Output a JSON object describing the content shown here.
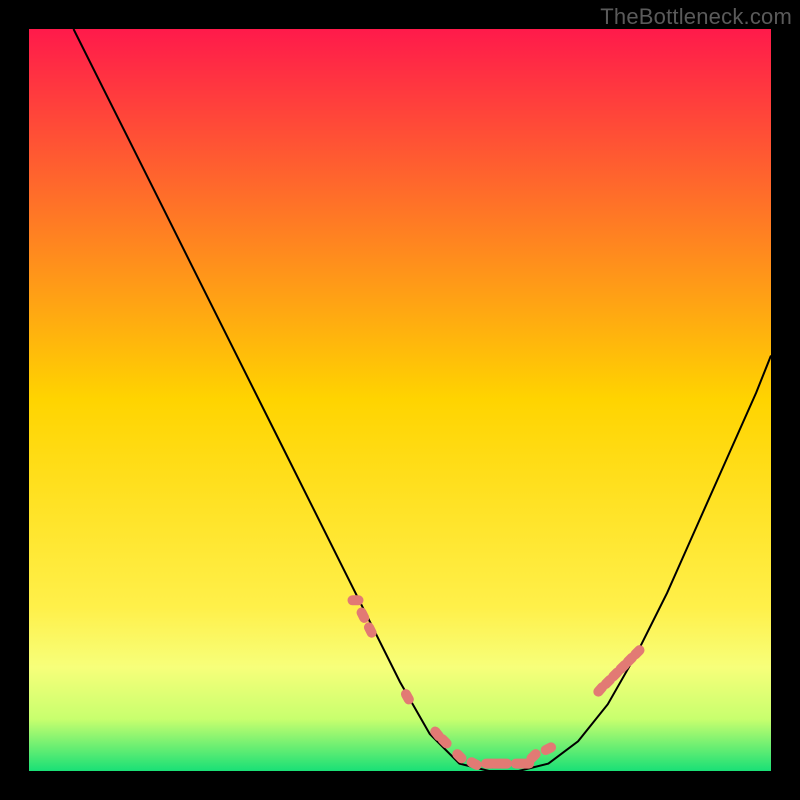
{
  "watermark": "TheBottleneck.com",
  "colors": {
    "frame": "#000000",
    "curve": "#000000",
    "markers": "#e27a74",
    "gradient_top": "#ff1a4b",
    "gradient_mid": "#ffd400",
    "gradient_band": "#f7ff7a",
    "gradient_bottom": "#19e076"
  },
  "chart_data": {
    "type": "line",
    "title": "",
    "xlabel": "",
    "ylabel": "",
    "xlim": [
      0,
      100
    ],
    "ylim": [
      0,
      100
    ],
    "grid": false,
    "legend": false,
    "series": [
      {
        "name": "curve",
        "x": [
          6,
          10,
          14,
          18,
          22,
          26,
          30,
          34,
          38,
          42,
          46,
          50,
          54,
          58,
          62,
          66,
          70,
          74,
          78,
          82,
          86,
          90,
          94,
          98,
          100
        ],
        "y": [
          100,
          92,
          84,
          76,
          68,
          60,
          52,
          44,
          36,
          28,
          20,
          12,
          5,
          1,
          0,
          0,
          1,
          4,
          9,
          16,
          24,
          33,
          42,
          51,
          56
        ]
      }
    ],
    "markers": {
      "name": "highlight-points",
      "x": [
        44,
        45,
        46,
        51,
        55,
        56,
        58,
        60,
        62,
        63,
        64,
        66,
        67,
        68,
        70,
        77,
        78,
        79,
        80,
        81,
        82
      ],
      "y": [
        23,
        21,
        19,
        10,
        5,
        4,
        2,
        1,
        1,
        1,
        1,
        1,
        1,
        2,
        3,
        11,
        12,
        13,
        14,
        15,
        16
      ]
    }
  }
}
